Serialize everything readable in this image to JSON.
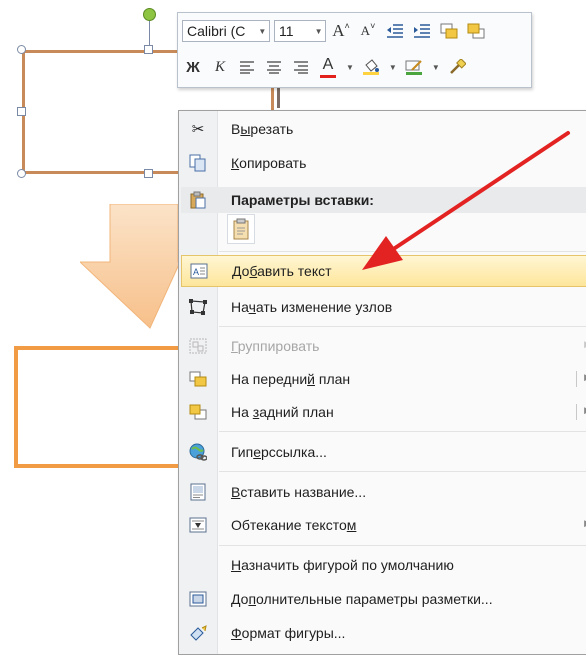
{
  "mini_toolbar": {
    "font_name": "Calibri (C",
    "font_size": "11",
    "grow_font": "A",
    "shrink_font": "A",
    "bold": "Ж",
    "italic": "К",
    "font_color_letter": "A"
  },
  "context_menu": {
    "items": [
      {
        "label_pre": "В",
        "label_u": "ы",
        "label_post": "резать"
      },
      {
        "label_pre": "",
        "label_u": "К",
        "label_post": "опировать"
      },
      {
        "label_pre": "",
        "label_u": "",
        "label_post": ""
      },
      {
        "label_pre": "До",
        "label_u": "б",
        "label_post": "авить текст"
      },
      {
        "label_pre": "На",
        "label_u": "ч",
        "label_post": "ать изменение узлов"
      },
      {
        "label_pre": "",
        "label_u": "Г",
        "label_post": "руппировать"
      },
      {
        "label_pre": "На передни",
        "label_u": "й",
        "label_post": " план"
      },
      {
        "label_pre": "На ",
        "label_u": "з",
        "label_post": "адний план"
      },
      {
        "label_pre": "Гип",
        "label_u": "е",
        "label_post": "рссылка..."
      },
      {
        "label_pre": "",
        "label_u": "В",
        "label_post": "ставить название..."
      },
      {
        "label_pre": "Обтекание тексто",
        "label_u": "м",
        "label_post": ""
      },
      {
        "label_pre": "",
        "label_u": "Н",
        "label_post": "азначить фигурой по умолчанию"
      },
      {
        "label_pre": "До",
        "label_u": "п",
        "label_post": "олнительные параметры разметки..."
      },
      {
        "label_pre": "",
        "label_u": "Ф",
        "label_post": "ормат фигуры..."
      }
    ],
    "paste_header": "Параметры вставки:"
  },
  "colors": {
    "highlight": "#fde69b",
    "font_color": "#e2211c",
    "fill_color": "#ffd23f",
    "outline_color": "#4aa53f",
    "annotation_red": "#e32222",
    "shape_outline": "#c88a58",
    "arrow_fill": "#fbd6b0"
  }
}
